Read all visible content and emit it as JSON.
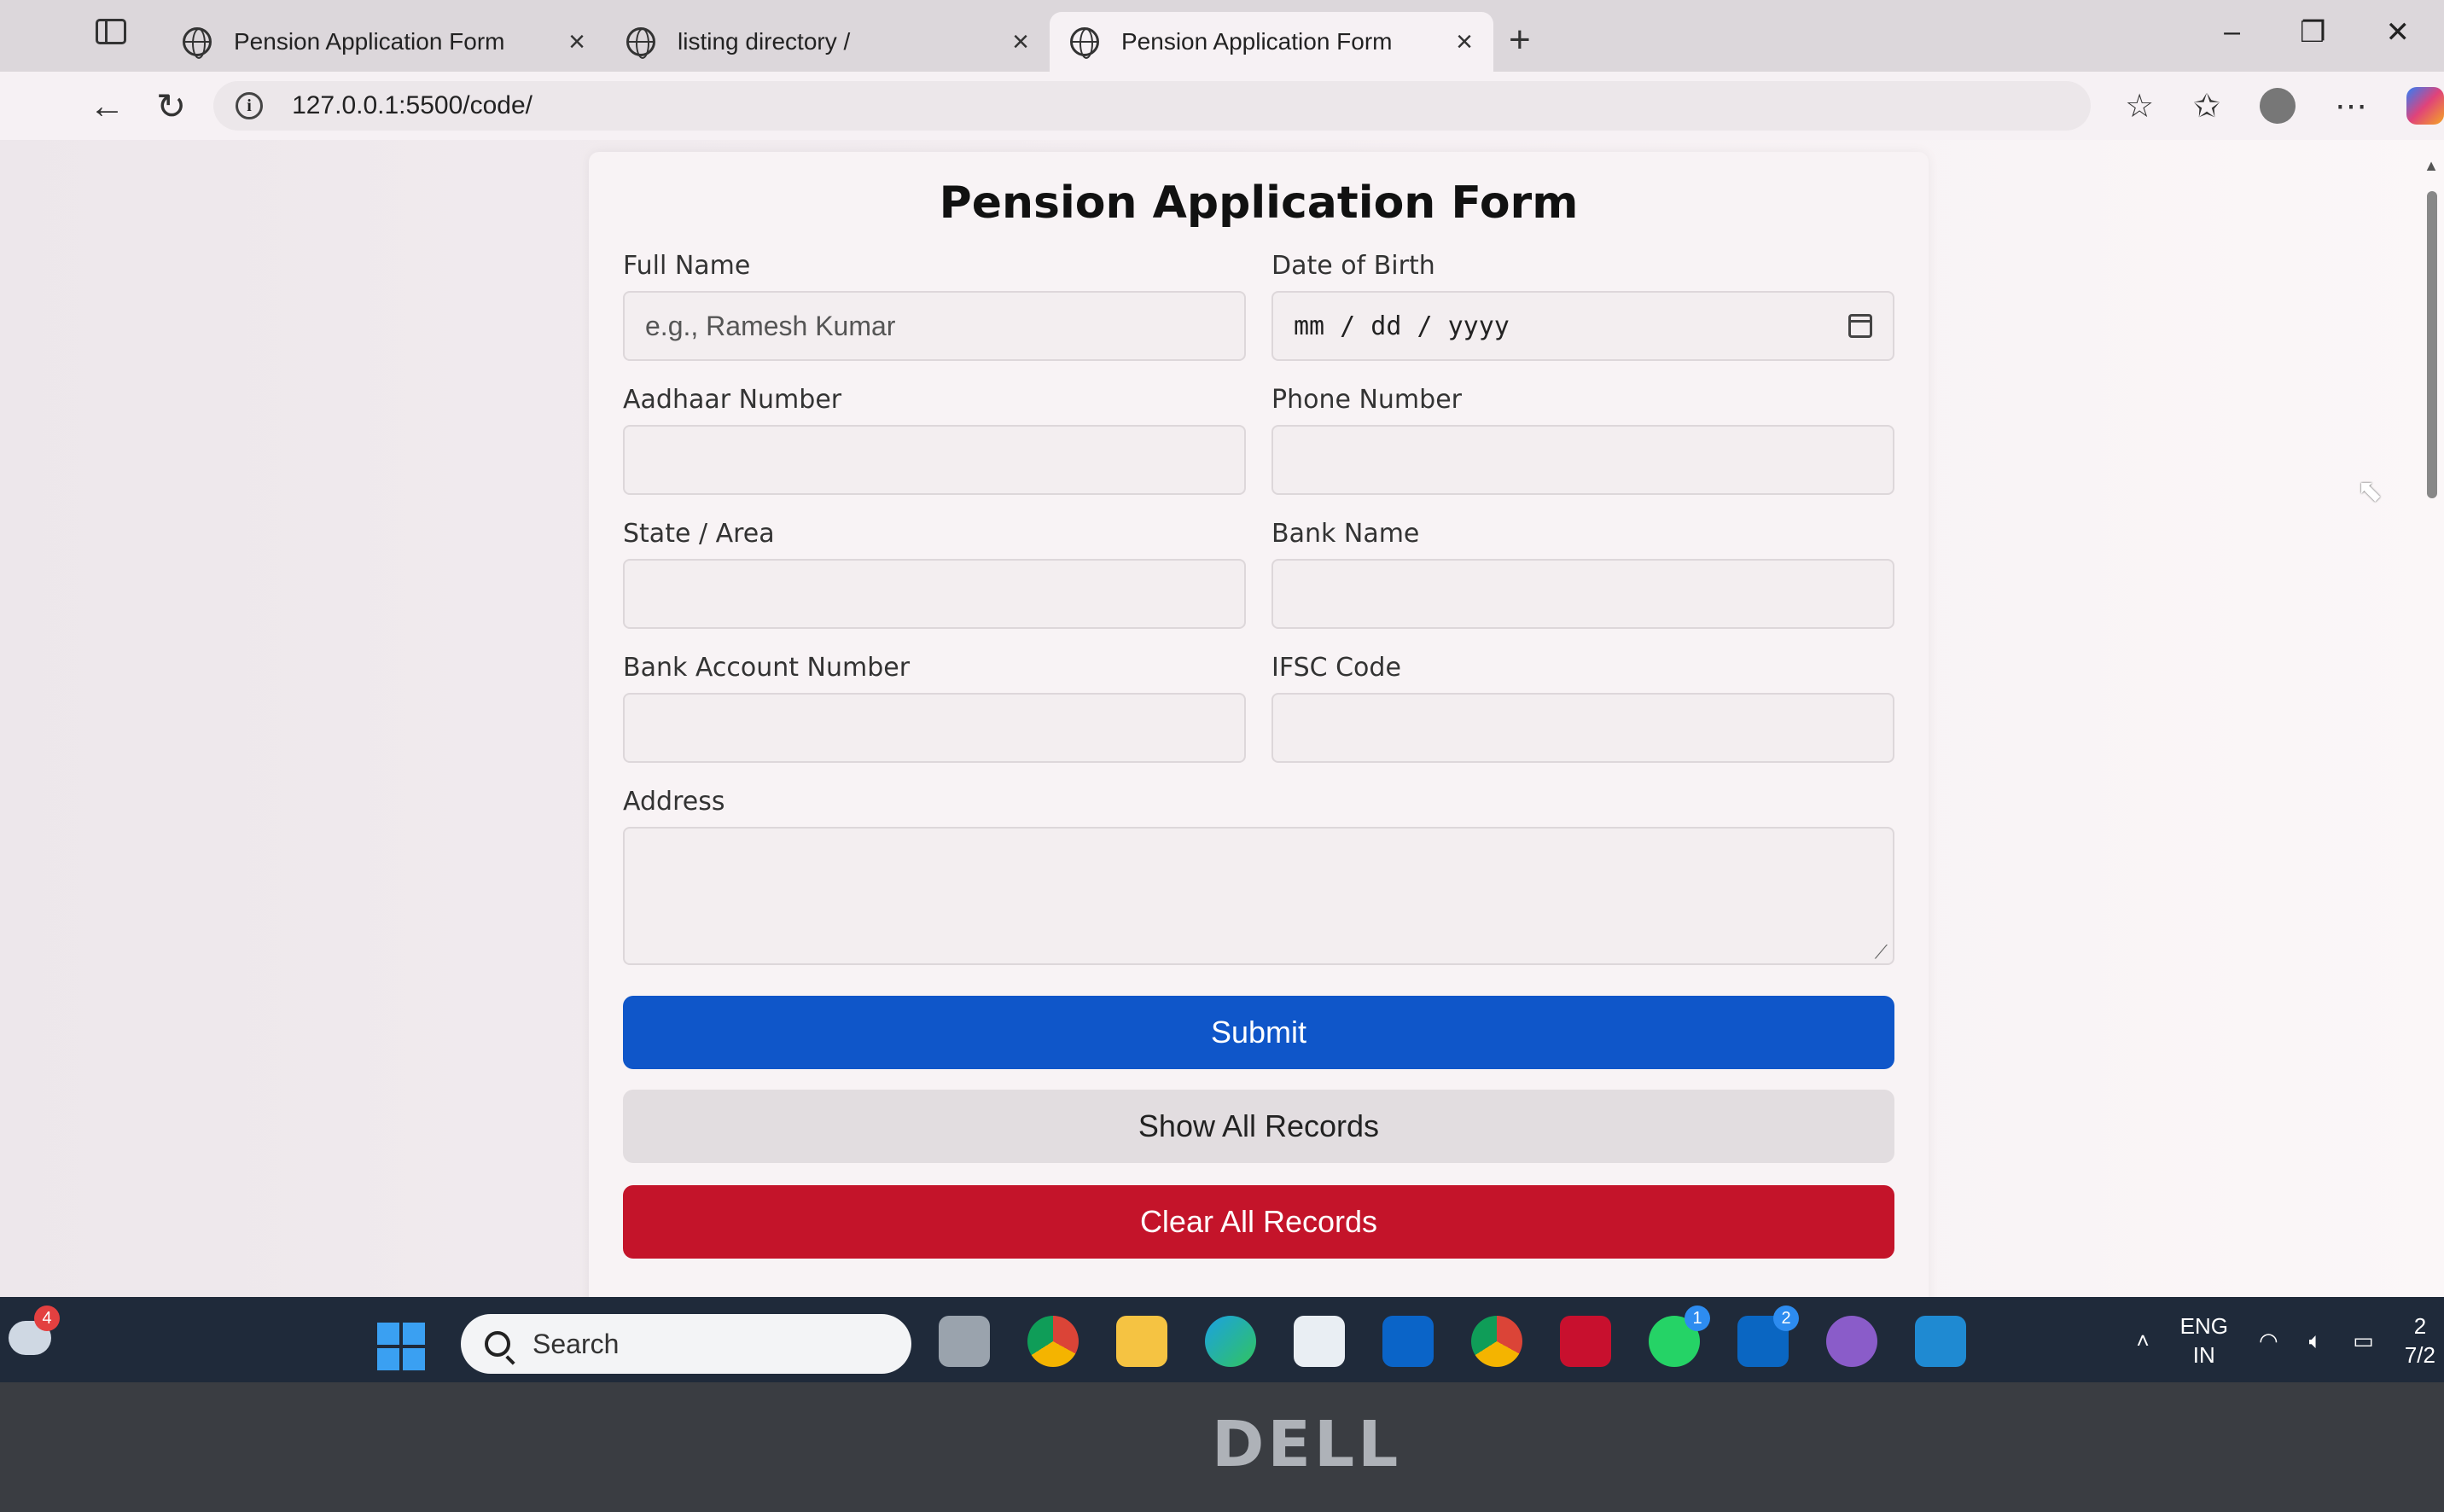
{
  "browser": {
    "tabs": [
      {
        "title": "Pension Application Form"
      },
      {
        "title": "listing directory /"
      },
      {
        "title": "Pension Application Form"
      }
    ],
    "url": "127.0.0.1:5500/code/"
  },
  "form": {
    "title": "Pension Application Form",
    "fields": {
      "full_name": {
        "label": "Full Name",
        "placeholder": "e.g., Ramesh Kumar"
      },
      "dob": {
        "label": "Date of Birth",
        "placeholder": "mm / dd / yyyy"
      },
      "aadhaar": {
        "label": "Aadhaar Number",
        "value": ""
      },
      "phone": {
        "label": "Phone Number",
        "value": ""
      },
      "state": {
        "label": "State / Area",
        "value": ""
      },
      "bank_name": {
        "label": "Bank Name",
        "value": ""
      },
      "account": {
        "label": "Bank Account Number",
        "value": ""
      },
      "ifsc": {
        "label": "IFSC Code",
        "value": ""
      },
      "address": {
        "label": "Address",
        "value": ""
      }
    },
    "buttons": {
      "submit": "Submit",
      "show": "Show All Records",
      "clear": "Clear All Records"
    },
    "colors": {
      "submit": "#0f56c9",
      "clear": "#c4142a",
      "show": "#e2dde0"
    }
  },
  "taskbar": {
    "search_label": "Search",
    "weather_badge": "4",
    "whatsapp_badge": "1",
    "linkedin_badge": "2",
    "lang_line1": "ENG",
    "lang_line2": "IN",
    "clock_partial": "2",
    "date_partial": "7/2",
    "apps": [
      "task-view",
      "chrome",
      "file-explorer",
      "edge",
      "store",
      "outlook",
      "chrome-profile",
      "mcafee",
      "whatsapp",
      "linkedin",
      "github",
      "vscode"
    ]
  },
  "bezel": {
    "brand": "DELL"
  }
}
